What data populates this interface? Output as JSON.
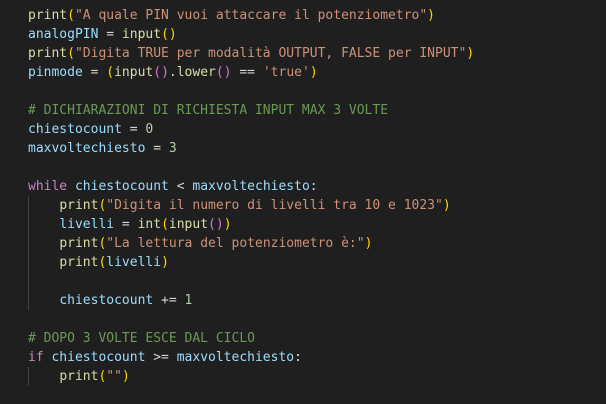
{
  "editor": {
    "lines": [
      [
        {
          "t": "print",
          "c": "fn"
        },
        {
          "t": "(",
          "c": "p1"
        },
        {
          "t": "\"A quale PIN vuoi attaccare il potenziometro\"",
          "c": "str"
        },
        {
          "t": ")",
          "c": "p1"
        }
      ],
      [
        {
          "t": "analogPIN",
          "c": "var"
        },
        {
          "t": " = ",
          "c": "op"
        },
        {
          "t": "input",
          "c": "fn"
        },
        {
          "t": "()",
          "c": "p1"
        }
      ],
      [
        {
          "t": "print",
          "c": "fn"
        },
        {
          "t": "(",
          "c": "p1"
        },
        {
          "t": "\"Digita TRUE per modalità OUTPUT, FALSE per INPUT\"",
          "c": "str"
        },
        {
          "t": ")",
          "c": "p1"
        }
      ],
      [
        {
          "t": "pinmode",
          "c": "var"
        },
        {
          "t": " = ",
          "c": "op"
        },
        {
          "t": "(",
          "c": "p1"
        },
        {
          "t": "input",
          "c": "fn"
        },
        {
          "t": "()",
          "c": "p2"
        },
        {
          "t": ".",
          "c": "op"
        },
        {
          "t": "lower",
          "c": "fn"
        },
        {
          "t": "()",
          "c": "p2"
        },
        {
          "t": " == ",
          "c": "op"
        },
        {
          "t": "'true'",
          "c": "str"
        },
        {
          "t": ")",
          "c": "p1"
        }
      ],
      [],
      [
        {
          "t": "# DICHIARAZIONI DI RICHIESTA INPUT MAX 3 VOLTE",
          "c": "cm"
        }
      ],
      [
        {
          "t": "chiestocount",
          "c": "var"
        },
        {
          "t": " = ",
          "c": "op"
        },
        {
          "t": "0",
          "c": "num"
        }
      ],
      [
        {
          "t": "maxvoltechiesto",
          "c": "var"
        },
        {
          "t": " = ",
          "c": "op"
        },
        {
          "t": "3",
          "c": "num"
        }
      ],
      [],
      [
        {
          "t": "while",
          "c": "kw"
        },
        {
          "t": " ",
          "c": "op"
        },
        {
          "t": "chiestocount",
          "c": "var"
        },
        {
          "t": " < ",
          "c": "op"
        },
        {
          "t": "maxvoltechiesto",
          "c": "var"
        },
        {
          "t": ":",
          "c": "op"
        }
      ],
      [
        {
          "t": "    ",
          "c": "op"
        },
        {
          "t": "print",
          "c": "fn"
        },
        {
          "t": "(",
          "c": "p1"
        },
        {
          "t": "\"Digita il numero di livelli tra 10 e 1023\"",
          "c": "str"
        },
        {
          "t": ")",
          "c": "p1"
        }
      ],
      [
        {
          "t": "    ",
          "c": "op"
        },
        {
          "t": "livelli",
          "c": "var"
        },
        {
          "t": " = ",
          "c": "op"
        },
        {
          "t": "int",
          "c": "fn"
        },
        {
          "t": "(",
          "c": "p1"
        },
        {
          "t": "input",
          "c": "fn"
        },
        {
          "t": "()",
          "c": "p2"
        },
        {
          "t": ")",
          "c": "p1"
        }
      ],
      [
        {
          "t": "    ",
          "c": "op"
        },
        {
          "t": "print",
          "c": "fn"
        },
        {
          "t": "(",
          "c": "p1"
        },
        {
          "t": "\"La lettura del potenziometro è:\"",
          "c": "str"
        },
        {
          "t": ")",
          "c": "p1"
        }
      ],
      [
        {
          "t": "    ",
          "c": "op"
        },
        {
          "t": "print",
          "c": "fn"
        },
        {
          "t": "(",
          "c": "p1"
        },
        {
          "t": "livelli",
          "c": "var"
        },
        {
          "t": ")",
          "c": "p1"
        }
      ],
      [],
      [
        {
          "t": "    ",
          "c": "op"
        },
        {
          "t": "chiestocount",
          "c": "var"
        },
        {
          "t": " += ",
          "c": "op"
        },
        {
          "t": "1",
          "c": "num"
        }
      ],
      [],
      [
        {
          "t": "# DOPO 3 VOLTE ESCE DAL CICLO",
          "c": "cm"
        }
      ],
      [
        {
          "t": "if",
          "c": "kw"
        },
        {
          "t": " ",
          "c": "op"
        },
        {
          "t": "chiestocount",
          "c": "var"
        },
        {
          "t": " >= ",
          "c": "op"
        },
        {
          "t": "maxvoltechiesto",
          "c": "var"
        },
        {
          "t": ":",
          "c": "op"
        }
      ],
      [
        {
          "t": "    ",
          "c": "op"
        },
        {
          "t": "print",
          "c": "fn"
        },
        {
          "t": "(",
          "c": "p1"
        },
        {
          "t": "\"\"",
          "c": "str"
        },
        {
          "t": ")",
          "c": "p1"
        }
      ]
    ]
  }
}
